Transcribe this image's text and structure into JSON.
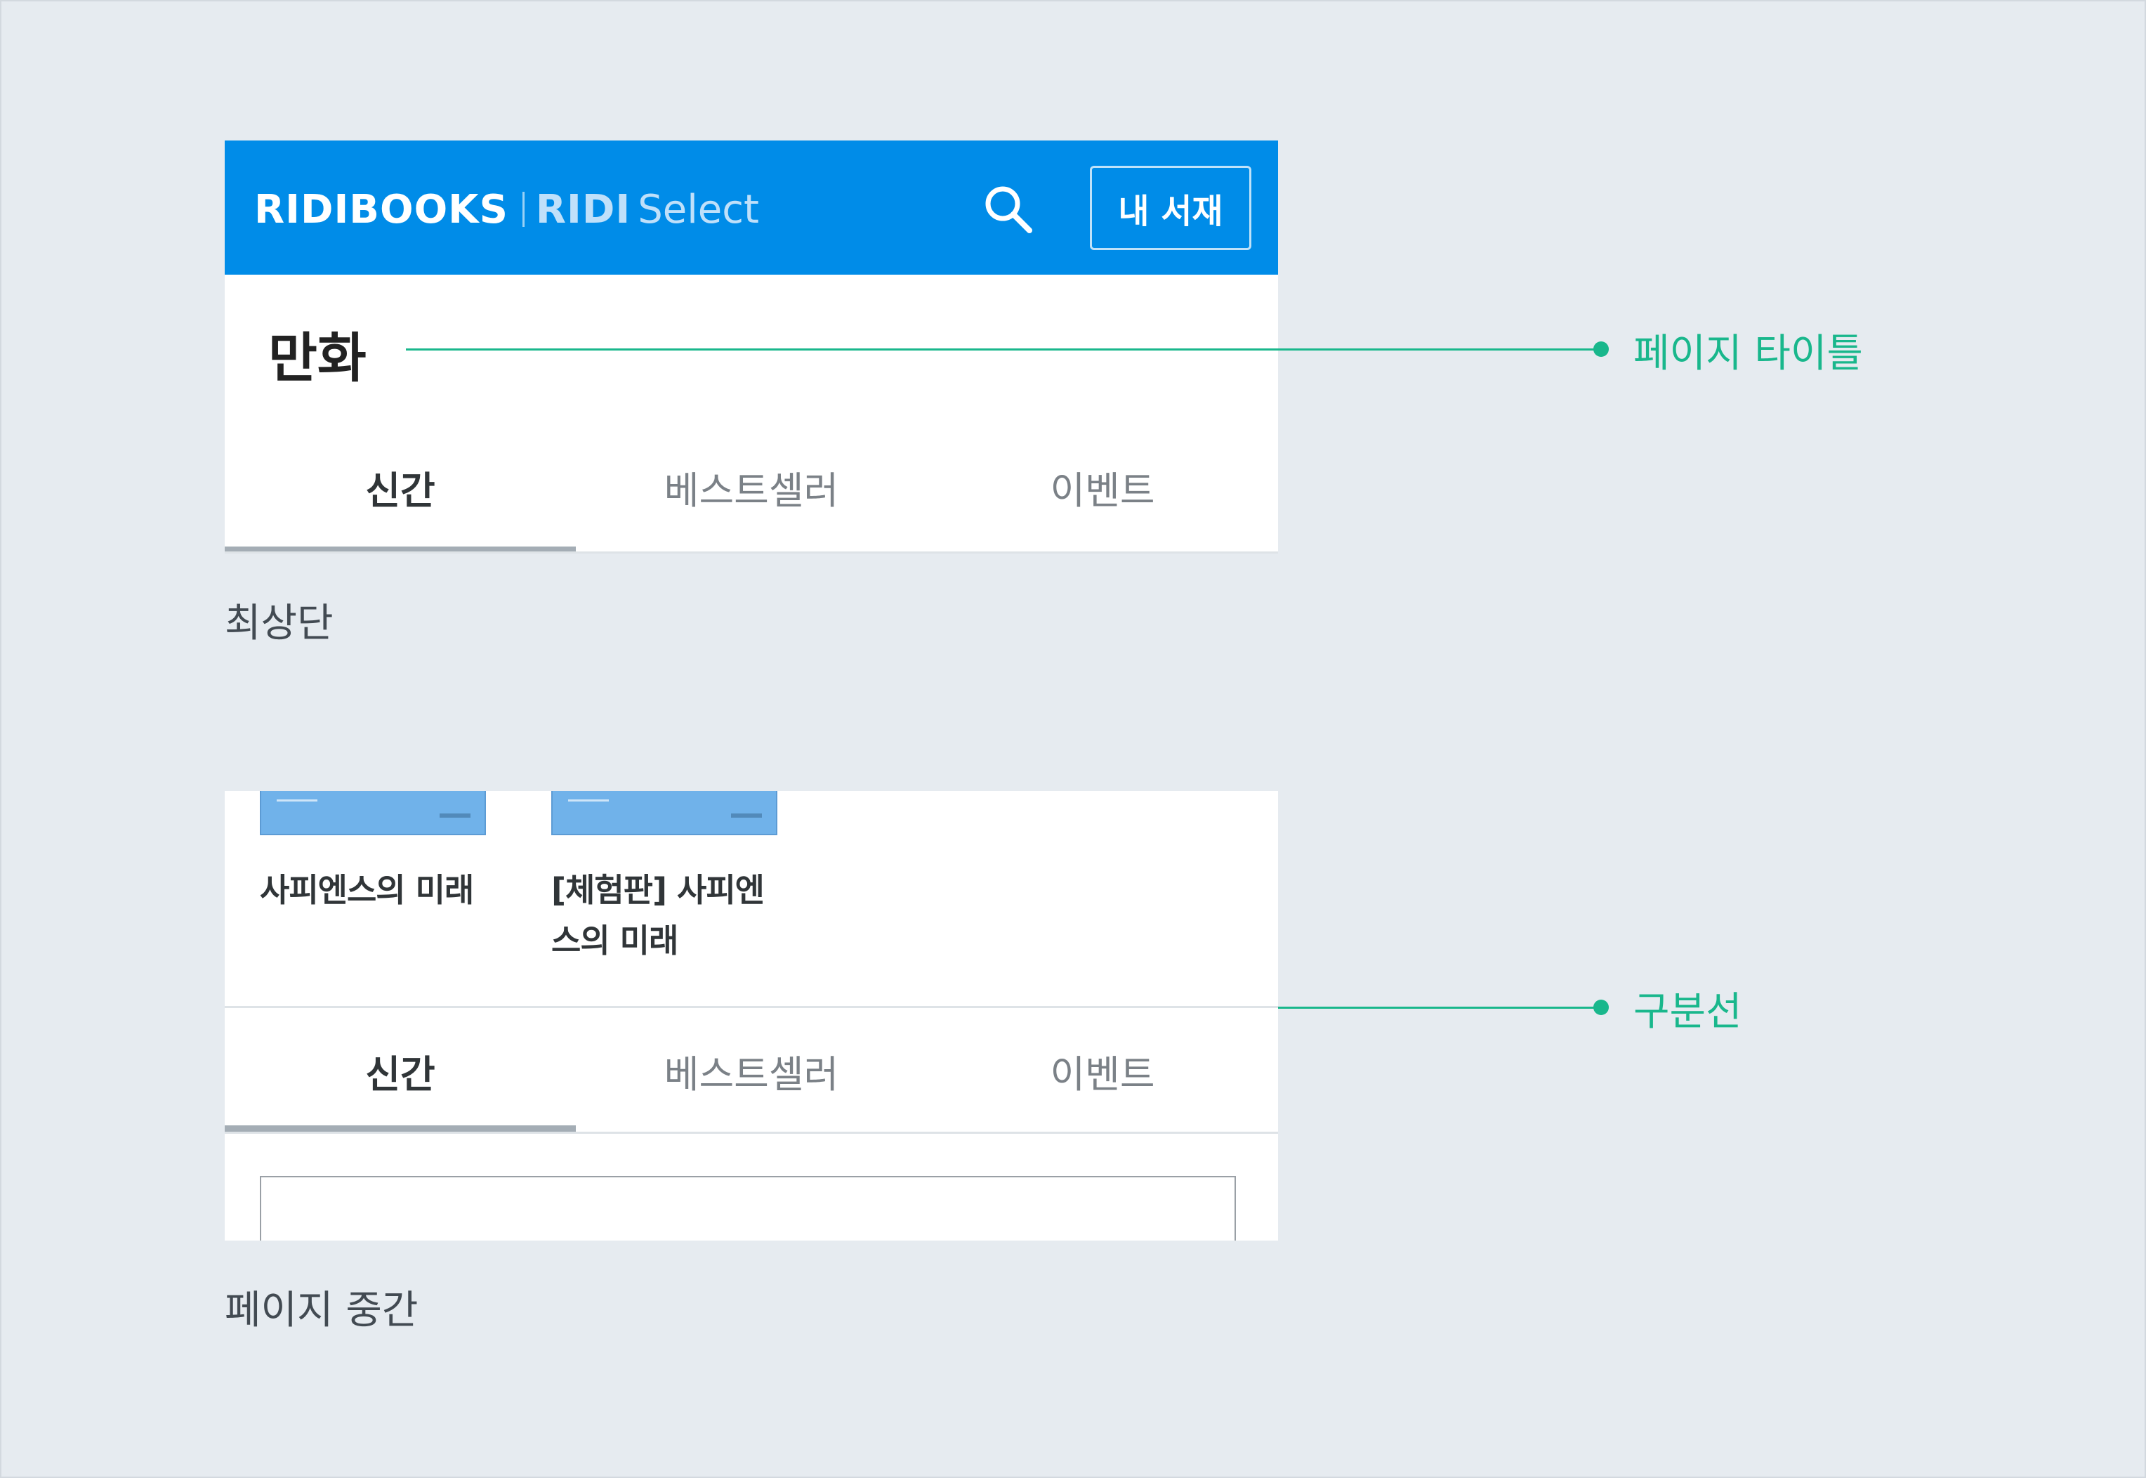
{
  "header": {
    "logo_main": "RIDIBOOKS",
    "logo_sub_bold": "RIDI",
    "logo_sub_light": "Select",
    "search_icon": "search-icon",
    "my_library_label": "내 서재",
    "brand_color": "#008ce8"
  },
  "top_panel": {
    "page_title": "만화",
    "tabs": [
      {
        "label": "신간",
        "active": true
      },
      {
        "label": "베스트셀러",
        "active": false
      },
      {
        "label": "이벤트",
        "active": false
      }
    ],
    "caption": "최상단"
  },
  "mid_panel": {
    "books": [
      {
        "title_line1": "사피엔스의 미래",
        "title_line2": ""
      },
      {
        "title_line1": "[체험판] 사피엔",
        "title_line2": "스의 미래"
      }
    ],
    "tabs": [
      {
        "label": "신간",
        "active": true
      },
      {
        "label": "베스트셀러",
        "active": false
      },
      {
        "label": "이벤트",
        "active": false
      }
    ],
    "caption": "페이지 중간"
  },
  "annotations": {
    "page_title_label": "페이지 타이틀",
    "divider_label": "구분선",
    "accent_color": "#19b78c"
  }
}
